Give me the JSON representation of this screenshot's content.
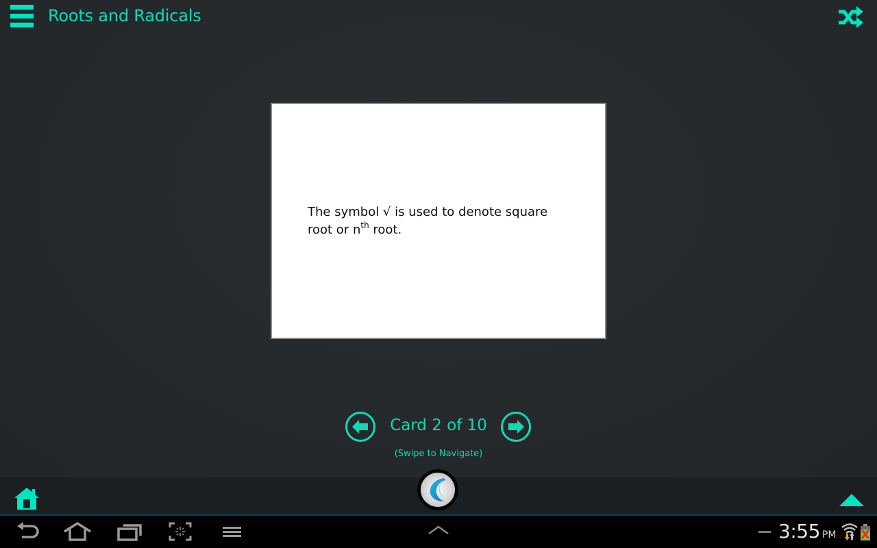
{
  "header": {
    "title": "Roots and Radicals",
    "menu_icon": "hamburger-menu-icon",
    "shuffle_icon": "shuffle-icon"
  },
  "card": {
    "text_before": "The symbol √ is used to denote square root or n",
    "superscript": "th",
    "text_after": " root."
  },
  "navigation": {
    "prev_icon": "arrow-left-circle-icon",
    "next_icon": "arrow-right-circle-icon",
    "counter": "Card 2 of 10",
    "current_card": 2,
    "total_cards": 10,
    "hint": "(Swipe to Navigate)"
  },
  "bottom_bar": {
    "home_icon": "home-icon",
    "logo_icon": "app-logo-icon",
    "expand_icon": "triangle-up-icon"
  },
  "system_bar": {
    "buttons": [
      "back",
      "home",
      "recent-apps",
      "screenshot",
      "menu"
    ],
    "center_icon": "chevron-up-icon",
    "time": "3:55",
    "ampm": "PM",
    "wifi_icon": "wifi-icon",
    "battery_icon": "battery-error-icon"
  },
  "colors": {
    "accent": "#10d9b8",
    "background": "#25292c",
    "card": "#ffffff"
  }
}
